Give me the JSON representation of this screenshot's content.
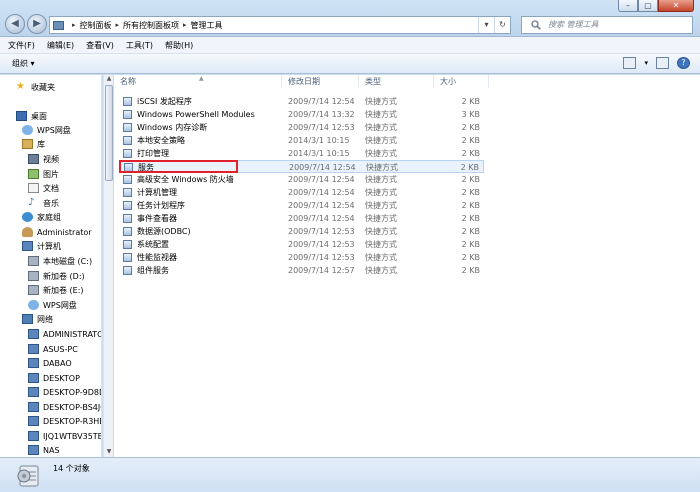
{
  "window": {
    "minimize": "–",
    "maximize": "▢",
    "close": "✕"
  },
  "address": {
    "sep_first": "▸",
    "crumbs": [
      "控制面板",
      "所有控制面板项",
      "管理工具"
    ],
    "refresh": "↻"
  },
  "search": {
    "placeholder": "搜索 管理工具"
  },
  "menu": [
    "文件(F)",
    "编辑(E)",
    "查看(V)",
    "工具(T)",
    "帮助(H)"
  ],
  "toolbar": {
    "organize": "组织 ▾",
    "help": "?"
  },
  "nav": {
    "favorites": "收藏夹",
    "desktop": "桌面",
    "wps_cloud": "WPS网盘",
    "library": "库",
    "videos": "视频",
    "pictures": "图片",
    "documents": "文档",
    "music": "音乐",
    "homegroup": "家庭组",
    "user": "Administrator",
    "computer": "计算机",
    "disk_c": "本地磁盘 (C:)",
    "disk_d": "新加卷 (D:)",
    "disk_e": "新加卷 (E:)",
    "wps_cloud2": "WPS网盘",
    "network": "网络",
    "hosts": [
      "ADMINISTRATO",
      "ASUS-PC",
      "DABAO",
      "DESKTOP",
      "DESKTOP-9D8DI",
      "DESKTOP-BS4JC",
      "DESKTOP-R3HEF",
      "IJQ1WTBV35TBZ",
      "NAS"
    ]
  },
  "columns": {
    "name": "名称",
    "date": "修改日期",
    "type": "类型",
    "size": "大小"
  },
  "files": [
    {
      "name": "iSCSI 发起程序",
      "date": "2009/7/14 12:54",
      "type": "快捷方式",
      "size": "2 KB"
    },
    {
      "name": "Windows PowerShell Modules",
      "date": "2009/7/14 13:32",
      "type": "快捷方式",
      "size": "3 KB"
    },
    {
      "name": "Windows 内存诊断",
      "date": "2009/7/14 12:53",
      "type": "快捷方式",
      "size": "2 KB"
    },
    {
      "name": "本地安全策略",
      "date": "2014/3/1 10:15",
      "type": "快捷方式",
      "size": "2 KB"
    },
    {
      "name": "打印管理",
      "date": "2014/3/1 10:15",
      "type": "快捷方式",
      "size": "2 KB"
    },
    {
      "name": "服务",
      "date": "2009/7/14 12:54",
      "type": "快捷方式",
      "size": "2 KB"
    },
    {
      "name": "高级安全 Windows 防火墙",
      "date": "2009/7/14 12:54",
      "type": "快捷方式",
      "size": "2 KB"
    },
    {
      "name": "计算机管理",
      "date": "2009/7/14 12:54",
      "type": "快捷方式",
      "size": "2 KB"
    },
    {
      "name": "任务计划程序",
      "date": "2009/7/14 12:54",
      "type": "快捷方式",
      "size": "2 KB"
    },
    {
      "name": "事件查看器",
      "date": "2009/7/14 12:54",
      "type": "快捷方式",
      "size": "2 KB"
    },
    {
      "name": "数据源(ODBC)",
      "date": "2009/7/14 12:53",
      "type": "快捷方式",
      "size": "2 KB"
    },
    {
      "name": "系统配置",
      "date": "2009/7/14 12:53",
      "type": "快捷方式",
      "size": "2 KB"
    },
    {
      "name": "性能监视器",
      "date": "2009/7/14 12:53",
      "type": "快捷方式",
      "size": "2 KB"
    },
    {
      "name": "组件服务",
      "date": "2009/7/14 12:57",
      "type": "快捷方式",
      "size": "2 KB"
    }
  ],
  "status": {
    "count": "14 个对象"
  }
}
